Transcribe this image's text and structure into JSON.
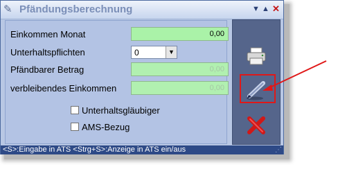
{
  "window": {
    "title": "Pfändungsberechnung",
    "title_icon": "pen-icon",
    "buttons": [
      "minimize-icon",
      "maximize-icon",
      "close-icon"
    ]
  },
  "form": {
    "fields": [
      {
        "label": "Einkommen Monat",
        "value": "0,00"
      },
      {
        "label": "Pfändbarer Betrag",
        "value": "0,00"
      },
      {
        "label": "verbleibendes Einkommen",
        "value": "0,00"
      }
    ],
    "unterhalt": {
      "label": "Unterhaltspflichten",
      "value": "0"
    },
    "checkboxes": [
      {
        "label": "Unterhaltsgläubiger",
        "checked": false
      },
      {
        "label": "AMS-Bezug",
        "checked": false
      }
    ]
  },
  "side_buttons": [
    "printer-icon",
    "pen-icon",
    "cancel-icon"
  ],
  "statusbar": {
    "text": "<S>:Eingabe in ATS  <Strg+S>:Anzeige in ATS ein/aus"
  },
  "colors": {
    "field_bg": "#aaf2a8",
    "panel": "#b3c3e4",
    "sidebar": "#55658b",
    "highlight": "#e01818",
    "statusbar": "#2e4a87"
  }
}
